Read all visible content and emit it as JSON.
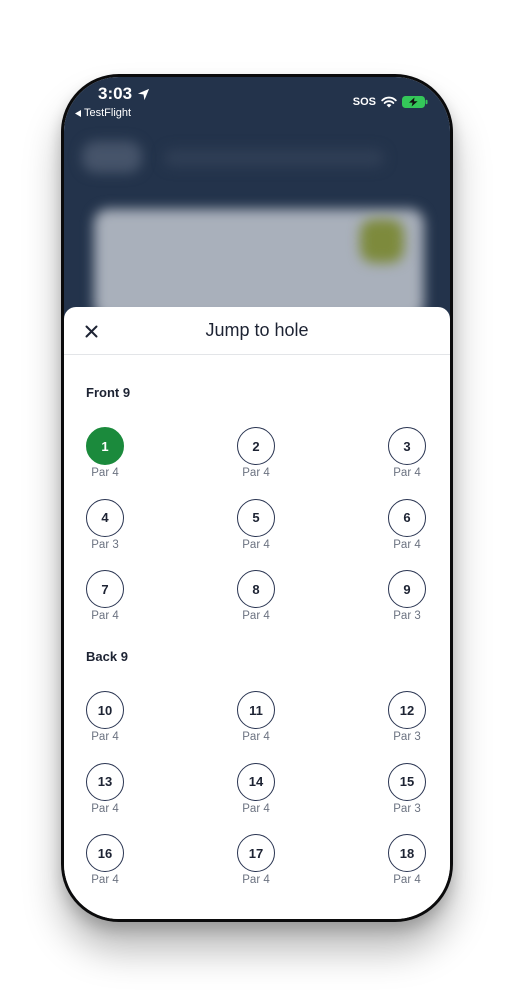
{
  "status_bar": {
    "time": "3:03",
    "back_app": "TestFlight",
    "sos": "SOS"
  },
  "sheet": {
    "title": "Jump to hole"
  },
  "colors": {
    "selected": "#1b8a3c",
    "header_bg": "#23334b"
  },
  "front9": {
    "title": "Front 9",
    "holes": [
      {
        "number": "1",
        "par": "Par 4",
        "selected": true
      },
      {
        "number": "2",
        "par": "Par 4"
      },
      {
        "number": "3",
        "par": "Par 4"
      },
      {
        "number": "4",
        "par": "Par 3"
      },
      {
        "number": "5",
        "par": "Par 4"
      },
      {
        "number": "6",
        "par": "Par 4"
      },
      {
        "number": "7",
        "par": "Par 4"
      },
      {
        "number": "8",
        "par": "Par 4"
      },
      {
        "number": "9",
        "par": "Par 3"
      }
    ]
  },
  "back9": {
    "title": "Back 9",
    "holes": [
      {
        "number": "10",
        "par": "Par 4"
      },
      {
        "number": "11",
        "par": "Par 4"
      },
      {
        "number": "12",
        "par": "Par 3"
      },
      {
        "number": "13",
        "par": "Par 4"
      },
      {
        "number": "14",
        "par": "Par 4"
      },
      {
        "number": "15",
        "par": "Par 3"
      },
      {
        "number": "16",
        "par": "Par 4"
      },
      {
        "number": "17",
        "par": "Par 4"
      },
      {
        "number": "18",
        "par": "Par 4"
      }
    ]
  }
}
